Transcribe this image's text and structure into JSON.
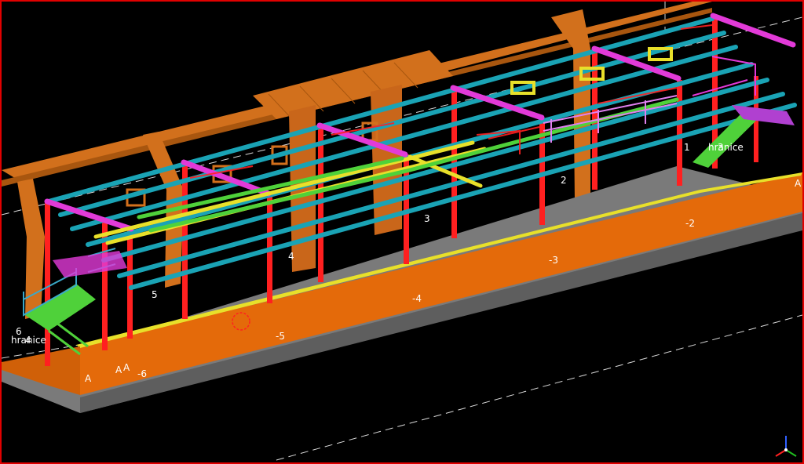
{
  "viewport": {
    "name": "3D model view",
    "border_color": "#e00000",
    "background": "#000000"
  },
  "colors": {
    "slab": "#e46a0a",
    "slab_top": "#c75a08",
    "column": "#ff2020",
    "beam_cyan": "#1aa3b5",
    "beam_magenta": "#e23ad8",
    "beam_yellow": "#e8e02a",
    "beam_green": "#4fd13a",
    "existing_timber": "#d2701c",
    "foundation": "#7a7a7a",
    "grid_line": "#ffffff"
  },
  "grid_labels": {
    "front": [
      "-2",
      "-3",
      "-4",
      "-5",
      "-6"
    ],
    "back": [
      "1",
      "2",
      "3",
      "4",
      "5",
      "6"
    ],
    "letters": [
      "A",
      "A",
      "A",
      "A"
    ],
    "other": [
      "hranice",
      "hranice",
      "3",
      "4"
    ]
  },
  "axis_triad": {
    "icon": "xyz-axis-icon"
  }
}
